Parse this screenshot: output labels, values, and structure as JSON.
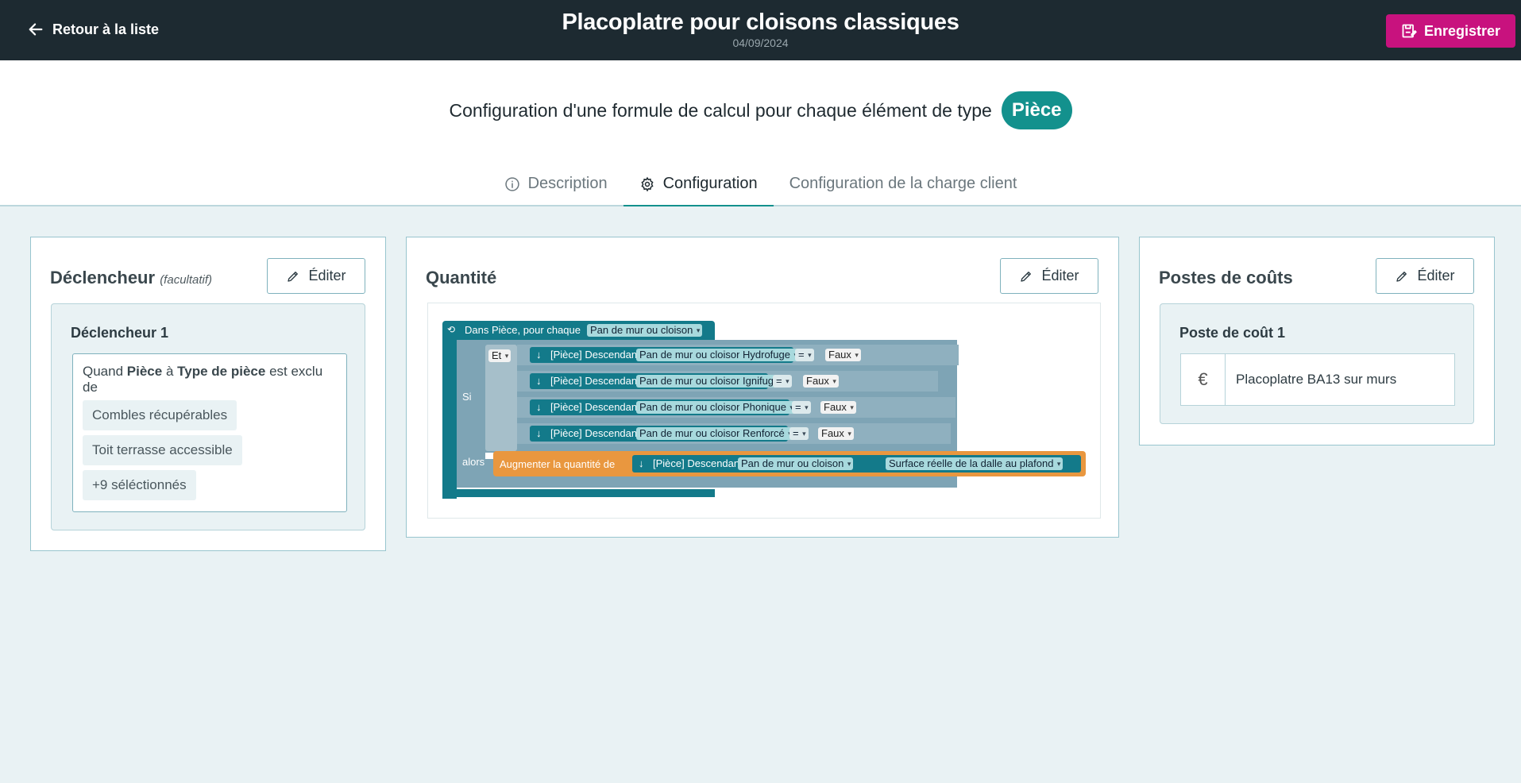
{
  "header": {
    "back_label": "Retour à la liste",
    "title": "Placoplatre pour cloisons classiques",
    "date": "04/09/2024",
    "save_label": "Enregistrer",
    "save_color": "#c8127e"
  },
  "subtitle": {
    "text": "Configuration d'une formule de calcul pour chaque élément de type",
    "type": "Pièce"
  },
  "tabs": [
    {
      "label": "Description",
      "icon": "info-icon"
    },
    {
      "label": "Configuration",
      "icon": "gear-icon"
    },
    {
      "label": "Configuration de la charge client",
      "icon": ""
    }
  ],
  "trigger_card": {
    "title": "Déclencheur",
    "optional": "(facultatif)",
    "edit_label": "Éditer",
    "trigger_title": "Déclencheur 1",
    "condition": {
      "quand": "Quand",
      "entity": "Pièce",
      "a": "à",
      "property": "Type de pièce",
      "rest": "est exclu de"
    },
    "chips": [
      "Combles récupérables",
      "Toit terrasse accessible",
      "+9 séléctionnés"
    ]
  },
  "quantity_card": {
    "title": "Quantité",
    "edit_label": "Éditer",
    "blocks": {
      "loop_label": "Dans Pièce, pour chaque",
      "loop_field": "Pan de mur ou cloison",
      "si": "Si",
      "et": "Et",
      "alors": "alors",
      "descendant": "[Pièce] Descendant :",
      "pan": "Pan de mur ou cloison",
      "eq": "=",
      "faux": "Faux",
      "props": [
        "Hydrofuge",
        "Ignifugé",
        "Phonique",
        "Renforcé"
      ],
      "augment_label": "Augmenter la quantité de",
      "surface": "Surface réelle de la dalle au plafond"
    }
  },
  "cost_card": {
    "title": "Postes de coûts",
    "edit_label": "Éditer",
    "item_title": "Poste de coût 1",
    "item_icon": "euro-icon",
    "item_label": "Placoplatre BA13 sur murs"
  },
  "colors": {
    "primary_teal": "#13918d",
    "dark_header": "#1d2a31",
    "accent_pink": "#c8127e",
    "block_teal": "#137a8a",
    "block_grey": "#7ea4b5",
    "block_orange": "#e9973f"
  }
}
